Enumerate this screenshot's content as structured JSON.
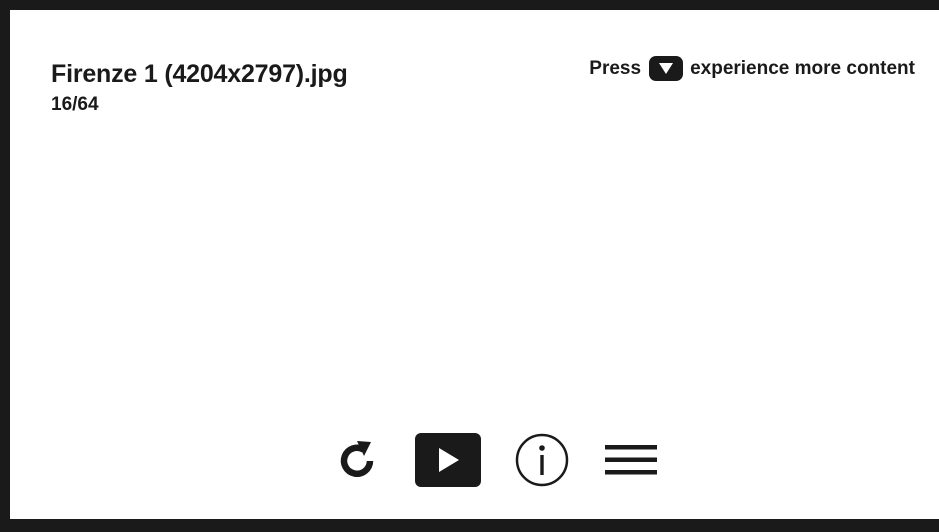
{
  "photo_viewer": {
    "file_name": "Firenze 1 (4204x2797).jpg",
    "position": "16/64"
  },
  "hint": {
    "prefix": "Press",
    "key_icon": "down-arrow-key-icon",
    "suffix": "experience more content"
  },
  "controls": [
    {
      "name": "refresh",
      "icon": "refresh-icon"
    },
    {
      "name": "slideshow-play",
      "icon": "play-icon"
    },
    {
      "name": "info",
      "icon": "info-icon"
    },
    {
      "name": "menu",
      "icon": "menu-icon"
    }
  ],
  "colors": {
    "background": "#ffffff",
    "frame": "#1a1a1a",
    "foreground": "#1a1a1a"
  }
}
